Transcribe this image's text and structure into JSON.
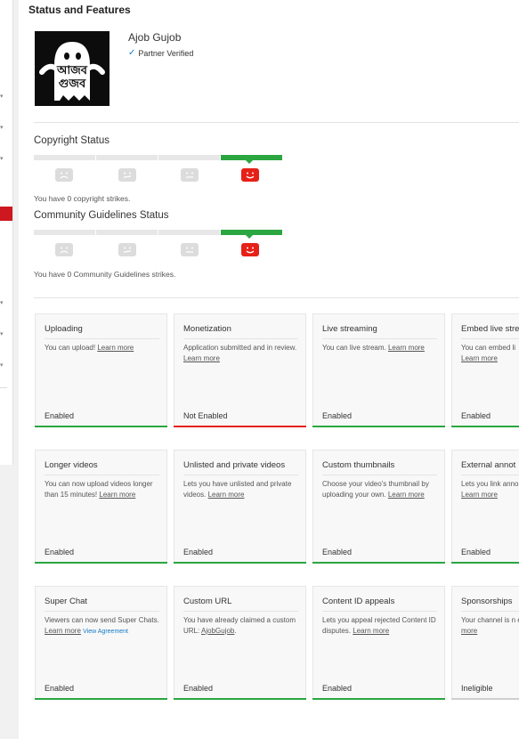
{
  "page": {
    "title": "Status and Features"
  },
  "channel": {
    "name": "Ajob Gujob",
    "verified_label": "Partner Verified",
    "avatar_text_line1": "আজব",
    "avatar_text_line2": "গুজব"
  },
  "copyright": {
    "title": "Copyright Status",
    "strikes_text": "You have 0 copyright strikes."
  },
  "community": {
    "title": "Community Guidelines Status",
    "strikes_text": "You have 0 Community Guidelines strikes."
  },
  "colors": {
    "enabled": "#2ba640",
    "not_enabled": "#e62117",
    "ineligible": "#cfcfcf",
    "link_blue": "#167ac6",
    "sidebar_active": "#cc181e"
  },
  "features": [
    {
      "title": "Uploading",
      "text": "You can upload! ",
      "link": "Learn more",
      "status": "Enabled",
      "state": "enabled"
    },
    {
      "title": "Monetization",
      "text": "Application submitted and in review. ",
      "link": "Learn more",
      "status": "Not Enabled",
      "state": "not_enabled"
    },
    {
      "title": "Live streaming",
      "text": "You can live stream. ",
      "link": "Learn more",
      "status": "Enabled",
      "state": "enabled"
    },
    {
      "title": "Embed live stre",
      "text": "You can embed li",
      "link": "Learn more",
      "status": "Enabled",
      "state": "enabled"
    },
    {
      "title": "Longer videos",
      "text": "You can now upload videos longer than 15 minutes! ",
      "link": "Learn more",
      "status": "Enabled",
      "state": "enabled"
    },
    {
      "title": "Unlisted and private videos",
      "text": "Lets you have unlisted and private videos. ",
      "link": "Learn more",
      "status": "Enabled",
      "state": "enabled"
    },
    {
      "title": "Custom thumbnails",
      "text": "Choose your video's thumbnail by uploading your own. ",
      "link": "Learn more",
      "status": "Enabled",
      "state": "enabled"
    },
    {
      "title": "External annot",
      "text": "Lets you link anno external sites or ",
      "link": "Learn more",
      "status": "Enabled",
      "state": "enabled"
    },
    {
      "title": "Super Chat",
      "text": "Viewers can now send Super Chats. ",
      "link": "Learn more",
      "extra_link": "View Agreement",
      "status": "Enabled",
      "state": "enabled"
    },
    {
      "title": "Custom URL",
      "text": "You have already claimed a custom URL: ",
      "link": "AjobGujob",
      "text_after": ".",
      "status": "Enabled",
      "state": "enabled"
    },
    {
      "title": "Content ID appeals",
      "text": "Lets you appeal rejected Content ID disputes. ",
      "link": "Learn more",
      "status": "Enabled",
      "state": "enabled"
    },
    {
      "title": "Sponsorships",
      "text": "Your channel is n eligible for sponso",
      "link": "more",
      "status": "Ineligible",
      "state": "ineligible"
    }
  ]
}
